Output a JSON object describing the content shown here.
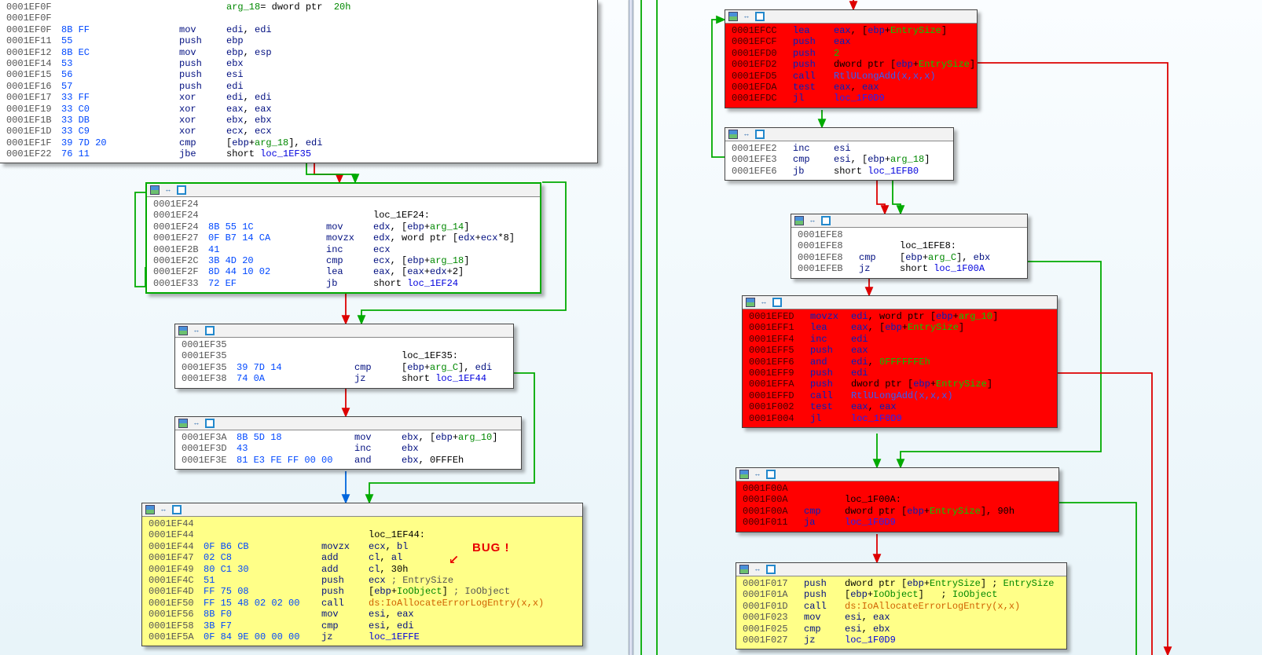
{
  "chart_data": null,
  "left": {
    "top_block": {
      "addr0": "0001EF0F",
      "lines": [
        {
          "a": "0001EF0F",
          "b": "",
          "m": "",
          "op": "arg_18= dword ptr  20h",
          "special": "argdef"
        },
        {
          "a": "0001EF0F",
          "b": "",
          "m": "",
          "op": ""
        },
        {
          "a": "0001EF0F",
          "b": "8B FF",
          "m": "mov",
          "op": "edi, edi"
        },
        {
          "a": "0001EF11",
          "b": "55",
          "m": "push",
          "op": "ebp"
        },
        {
          "a": "0001EF12",
          "b": "8B EC",
          "m": "mov",
          "op": "ebp, esp"
        },
        {
          "a": "0001EF14",
          "b": "53",
          "m": "push",
          "op": "ebx"
        },
        {
          "a": "0001EF15",
          "b": "56",
          "m": "push",
          "op": "esi"
        },
        {
          "a": "0001EF16",
          "b": "57",
          "m": "push",
          "op": "edi"
        },
        {
          "a": "0001EF17",
          "b": "33 FF",
          "m": "xor",
          "op": "edi, edi"
        },
        {
          "a": "0001EF19",
          "b": "33 C0",
          "m": "xor",
          "op": "eax, eax"
        },
        {
          "a": "0001EF1B",
          "b": "33 DB",
          "m": "xor",
          "op": "ebx, ebx"
        },
        {
          "a": "0001EF1D",
          "b": "33 C9",
          "m": "xor",
          "op": "ecx, ecx"
        },
        {
          "a": "0001EF1F",
          "b": "39 7D 20",
          "m": "cmp",
          "op": "[ebp+arg_18], edi",
          "arg": "arg_18"
        },
        {
          "a": "0001EF22",
          "b": "76 11",
          "m": "jbe",
          "op": "short loc_1EF35",
          "loc": "loc_1EF35"
        }
      ]
    },
    "loop_block": {
      "lines": [
        {
          "a": "0001EF24",
          "b": "",
          "m": "",
          "op": ""
        },
        {
          "a": "0001EF24",
          "b": "",
          "m": "",
          "op": "loc_1EF24:",
          "labeldef": true
        },
        {
          "a": "0001EF24",
          "b": "8B 55 1C",
          "m": "mov",
          "op": "edx, [ebp+arg_14]",
          "arg": "arg_14"
        },
        {
          "a": "0001EF27",
          "b": "0F B7 14 CA",
          "m": "movzx",
          "op": "edx, word ptr [edx+ecx*8]"
        },
        {
          "a": "0001EF2B",
          "b": "41",
          "m": "inc",
          "op": "ecx"
        },
        {
          "a": "0001EF2C",
          "b": "3B 4D 20",
          "m": "cmp",
          "op": "ecx, [ebp+arg_18]",
          "arg": "arg_18"
        },
        {
          "a": "0001EF2F",
          "b": "8D 44 10 02",
          "m": "lea",
          "op": "eax, [eax+edx+2]"
        },
        {
          "a": "0001EF33",
          "b": "72 EF",
          "m": "jb",
          "op": "short loc_1EF24",
          "loc": "loc_1EF24"
        }
      ]
    },
    "ef35_block": {
      "lines": [
        {
          "a": "0001EF35",
          "b": "",
          "m": "",
          "op": ""
        },
        {
          "a": "0001EF35",
          "b": "",
          "m": "",
          "op": "loc_1EF35:",
          "labeldef": true
        },
        {
          "a": "0001EF35",
          "b": "39 7D 14",
          "m": "cmp",
          "op": "[ebp+arg_C], edi",
          "arg": "arg_C"
        },
        {
          "a": "0001EF38",
          "b": "74 0A",
          "m": "jz",
          "op": "short loc_1EF44",
          "loc": "loc_1EF44"
        }
      ]
    },
    "ef3a_block": {
      "lines": [
        {
          "a": "0001EF3A",
          "b": "8B 5D 18",
          "m": "mov",
          "op": "ebx, [ebp+arg_10]",
          "arg": "arg_10"
        },
        {
          "a": "0001EF3D",
          "b": "43",
          "m": "inc",
          "op": "ebx"
        },
        {
          "a": "0001EF3E",
          "b": "81 E3 FE FF 00 00",
          "m": "and",
          "op": "ebx, 0FFFEh"
        }
      ]
    },
    "ef44_block": {
      "lines": [
        {
          "a": "0001EF44",
          "b": "",
          "m": "",
          "op": ""
        },
        {
          "a": "0001EF44",
          "b": "",
          "m": "",
          "op": "loc_1EF44:",
          "labeldef": true
        },
        {
          "a": "0001EF44",
          "b": "0F B6 CB",
          "m": "movzx",
          "op": "ecx, bl"
        },
        {
          "a": "0001EF47",
          "b": "02 C8",
          "m": "add",
          "op": "cl, al",
          "bugline": true
        },
        {
          "a": "0001EF49",
          "b": "80 C1 30",
          "m": "add",
          "op": "cl, 30h"
        },
        {
          "a": "0001EF4C",
          "b": "51",
          "m": "push",
          "op": "ecx",
          "cmt": "; EntrySize"
        },
        {
          "a": "0001EF4D",
          "b": "FF 75 08",
          "m": "push",
          "op": "[ebp+IoObject]",
          "arg": "IoObject",
          "cmt": "; IoObject"
        },
        {
          "a": "0001EF50",
          "b": "FF 15 48 02 02 00",
          "m": "call",
          "op": "ds:IoAllocateErrorLogEntry(x,x)",
          "call": true
        },
        {
          "a": "0001EF56",
          "b": "8B F0",
          "m": "mov",
          "op": "esi, eax"
        },
        {
          "a": "0001EF58",
          "b": "3B F7",
          "m": "cmp",
          "op": "esi, edi"
        },
        {
          "a": "0001EF5A",
          "b": "0F 84 9E 00 00 00",
          "m": "jz",
          "op": "loc_1EFFE",
          "loc": "loc_1EFFE"
        }
      ],
      "bug_label": "BUG !"
    }
  },
  "right": {
    "efcc_block": {
      "lines": [
        {
          "a": "0001EFCC",
          "m": "lea",
          "op": "eax, [ebp+EntrySize]",
          "arg": "EntrySize"
        },
        {
          "a": "0001EFCF",
          "m": "push",
          "op": "eax"
        },
        {
          "a": "0001EFD0",
          "m": "push",
          "op": "2",
          "num": true
        },
        {
          "a": "0001EFD2",
          "m": "push",
          "op": "dword ptr [ebp+EntrySize]",
          "arg": "EntrySize"
        },
        {
          "a": "0001EFD5",
          "m": "call",
          "op": "RtlULongAdd(x,x,x)",
          "call": true
        },
        {
          "a": "0001EFDA",
          "m": "test",
          "op": "eax, eax"
        },
        {
          "a": "0001EFDC",
          "m": "jl",
          "op": "loc_1F0D9",
          "loc": "loc_1F0D9"
        }
      ]
    },
    "efe2_block": {
      "lines": [
        {
          "a": "0001EFE2",
          "m": "inc",
          "op": "esi"
        },
        {
          "a": "0001EFE3",
          "m": "cmp",
          "op": "esi, [ebp+arg_18]",
          "arg": "arg_18"
        },
        {
          "a": "0001EFE6",
          "m": "jb",
          "op": "short loc_1EFB0",
          "loc": "loc_1EFB0"
        }
      ]
    },
    "efe8_block": {
      "lines": [
        {
          "a": "0001EFE8",
          "m": "",
          "op": ""
        },
        {
          "a": "0001EFE8",
          "m": "",
          "op": "loc_1EFE8:",
          "labeldef": true
        },
        {
          "a": "0001EFE8",
          "m": "cmp",
          "op": "[ebp+arg_C], ebx",
          "arg": "arg_C"
        },
        {
          "a": "0001EFEB",
          "m": "jz",
          "op": "short loc_1F00A",
          "loc": "loc_1F00A"
        }
      ]
    },
    "efed_block": {
      "lines": [
        {
          "a": "0001EFED",
          "m": "movzx",
          "op": "edi, word ptr [ebp+arg_10]",
          "arg": "arg_10"
        },
        {
          "a": "0001EFF1",
          "m": "lea",
          "op": "eax, [ebp+EntrySize]",
          "arg": "EntrySize"
        },
        {
          "a": "0001EFF4",
          "m": "inc",
          "op": "edi"
        },
        {
          "a": "0001EFF5",
          "m": "push",
          "op": "eax"
        },
        {
          "a": "0001EFF6",
          "m": "and",
          "op": "edi, 0FFFFFFEh",
          "num": true
        },
        {
          "a": "0001EFF9",
          "m": "push",
          "op": "edi"
        },
        {
          "a": "0001EFFA",
          "m": "push",
          "op": "dword ptr [ebp+EntrySize]",
          "arg": "EntrySize"
        },
        {
          "a": "0001EFFD",
          "m": "call",
          "op": "RtlULongAdd(x,x,x)",
          "call": true
        },
        {
          "a": "0001F002",
          "m": "test",
          "op": "eax, eax"
        },
        {
          "a": "0001F004",
          "m": "jl",
          "op": "loc_1F0D9",
          "loc": "loc_1F0D9"
        }
      ]
    },
    "f00a_block": {
      "lines": [
        {
          "a": "0001F00A",
          "m": "",
          "op": ""
        },
        {
          "a": "0001F00A",
          "m": "",
          "op": "loc_1F00A:",
          "labeldef": true
        },
        {
          "a": "0001F00A",
          "m": "cmp",
          "op": "dword ptr [ebp+EntrySize], 90h",
          "arg": "EntrySize"
        },
        {
          "a": "0001F011",
          "m": "ja",
          "op": "loc_1F0D9",
          "loc": "loc_1F0D9"
        }
      ]
    },
    "f017_block": {
      "lines": [
        {
          "a": "0001F017",
          "m": "push",
          "op": "dword ptr [ebp+EntrySize] ; EntrySize",
          "arg": "EntrySize"
        },
        {
          "a": "0001F01A",
          "m": "push",
          "op": "[ebp+IoObject]   ; IoObject",
          "arg": "IoObject"
        },
        {
          "a": "0001F01D",
          "m": "call",
          "op": "ds:IoAllocateErrorLogEntry(x,x)",
          "call": true
        },
        {
          "a": "0001F023",
          "m": "mov",
          "op": "esi, eax"
        },
        {
          "a": "0001F025",
          "m": "cmp",
          "op": "esi, ebx"
        },
        {
          "a": "0001F027",
          "m": "jz",
          "op": "loc_1F0D9",
          "loc": "loc_1F0D9"
        }
      ]
    }
  },
  "icons": {
    "i1": "bar",
    "i2": "swap",
    "i3": "grid"
  }
}
